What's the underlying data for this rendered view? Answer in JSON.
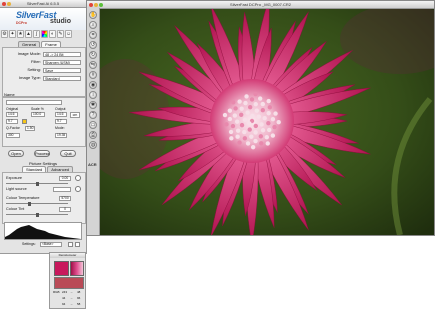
{
  "panel": {
    "title": "SilverFast Ai 6.5.5",
    "logo": {
      "main": "SilverFast",
      "sub": "DCPro",
      "studio": "studio"
    },
    "toolbar_icons": [
      "wrench-icon",
      "magic-wand-icon",
      "star-icon",
      "histogram-icon",
      "gradation-icon",
      "color-wheel-icon",
      "selective-color-icon",
      "dropper-icon",
      "person-icon"
    ],
    "tabs": [
      "General",
      "Frame"
    ],
    "general": {
      "image_mode_label": "Image Mode:",
      "image_mode_value": "48 -> 24 Bit",
      "filter_label": "Filter:",
      "filter_value": "Sharpen (USM)",
      "setting_label": "Setting:",
      "setting_value": "Save",
      "image_type_label": "Image Type:",
      "image_type_value": "Standard"
    },
    "name_label": "Name",
    "scan": {
      "original_label": "Original",
      "scale_label": "Scale %",
      "output_label": "Output",
      "w_orig": "14.6",
      "scale_value": "100.0",
      "w_out": "14.6",
      "h_orig": "9.7",
      "h_out": "9.7",
      "q_label": "Q-Factor",
      "q_value": "1.50",
      "mode_label": "Mode:",
      "res_value": "300",
      "lpi_value": "19.35",
      "unit": "cm"
    },
    "buttons": {
      "open": "Open",
      "process": "Process",
      "quit": "Quit"
    },
    "picture_settings_label": "Picture Settings",
    "adjust_tabs": [
      "Standard",
      "Advanced"
    ],
    "adjust": {
      "exposure_label": "Exposure",
      "exposure_value": "0.00",
      "light_source_label": "Light source",
      "colour_temp_label": "Colour Temperature",
      "colour_temp_value": "5700",
      "colour_tint_label": "Colour Tint",
      "colour_tint_value": "0"
    },
    "settings_label": "Settings:",
    "settings_value": "<Base>"
  },
  "densitometer": {
    "title": "Densitometer",
    "values": [
      {
        "label": "RGB",
        "a": "243",
        "b": "48"
      },
      {
        "label": "",
        "a": "44",
        "b": "96"
      },
      {
        "label": "",
        "a": "94",
        "b": "58"
      }
    ]
  },
  "image_window": {
    "title": "SilverFast DCPro _MG_0007.CR2",
    "side_label": "ACR",
    "side_tools": [
      "hand-icon",
      "zoom-icon",
      "crop-icon",
      "rotate-left-icon",
      "rotate-right-icon",
      "flip-icon",
      "grid-icon",
      "eye-icon",
      "info-icon",
      "settings-icon",
      "question-icon",
      "monitor-icon",
      "print-icon",
      "globe-icon"
    ]
  },
  "colors": {
    "accent": "#2a6fb8",
    "flower_magenta": "#c8185c",
    "flower_light": "#f3c6d8",
    "background_green": "#3c5a1e"
  }
}
